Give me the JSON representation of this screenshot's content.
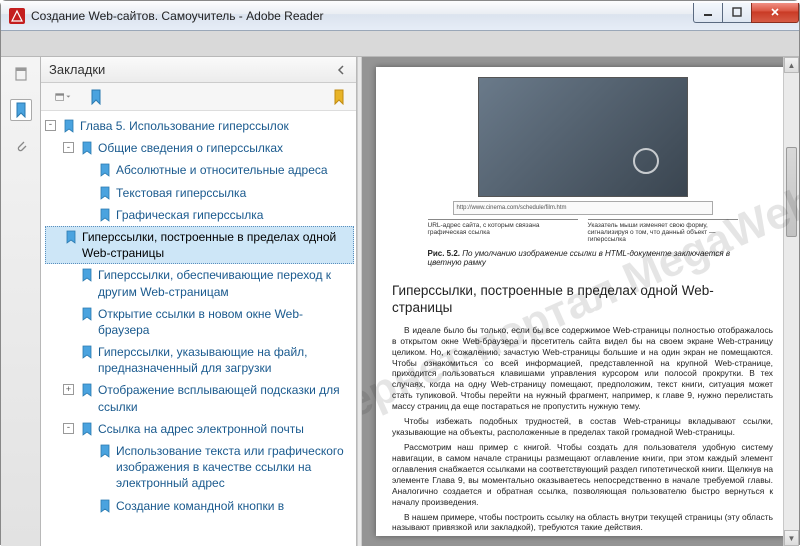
{
  "window": {
    "title": "Создание Web-сайтов. Самоучитель - Adobe Reader"
  },
  "bookmarks": {
    "panel_title": "Закладки",
    "items": [
      {
        "level": 1,
        "expander": "-",
        "label": "Глава 5. Использование гиперссылок",
        "selected": false
      },
      {
        "level": 2,
        "expander": "-",
        "label": "Общие сведения о гиперссылках",
        "selected": false
      },
      {
        "level": 3,
        "expander": "",
        "label": "Абсолютные и относительные адреса",
        "selected": false
      },
      {
        "level": 3,
        "expander": "",
        "label": "Текстовая гиперссылка",
        "selected": false
      },
      {
        "level": 3,
        "expander": "",
        "label": "Графическая гиперссылка",
        "selected": false
      },
      {
        "level": 2,
        "expander": "",
        "label": "Гиперссылки, построенные в пределах одной Web-страницы",
        "selected": true
      },
      {
        "level": 2,
        "expander": "",
        "label": "Гиперссылки, обеспечивающие переход к другим Web-страницам",
        "selected": false
      },
      {
        "level": 2,
        "expander": "",
        "label": "Открытие ссылки в новом окне Web-браузера",
        "selected": false
      },
      {
        "level": 2,
        "expander": "",
        "label": "Гиперссылки, указывающие на файл, предназначенный для загрузки",
        "selected": false
      },
      {
        "level": 2,
        "expander": "+",
        "label": "Отображение всплывающей подсказки для ссылки",
        "selected": false
      },
      {
        "level": 2,
        "expander": "-",
        "label": "Ссылка на адрес электронной почты",
        "selected": false
      },
      {
        "level": 3,
        "expander": "",
        "label": "Использование текста или графического изображения в качестве ссылки на электронный адрес",
        "selected": false
      },
      {
        "level": 3,
        "expander": "",
        "label": "Создание командной кнопки в",
        "selected": false
      }
    ]
  },
  "doc": {
    "url_bar": "http://www.cinema.com/schedule/film.htm",
    "annot_left": "URL-адрес сайта, с которым связана графическая ссылка",
    "annot_right": "Указатель мыши изменяет свою форму, сигнализируя о том, что данный объект — гиперссылка",
    "fig_num": "Рис. 5.2.",
    "fig_caption": " По умолчанию изображение ссылки в HTML-документе заключается в цветную рамку",
    "heading": "Гиперссылки, построенные в пределах одной Web-страницы",
    "p1": "В идеале было бы только, если бы все содержимое Web-страницы полностью отображалось в открытом окне Web-браузера и посетитель сайта видел бы на своем экране Web-страницу целиком. Но, к сожалению, зачастую Web-страницы большие и на один экран не помещаются. Чтобы ознакомиться со всей информацией, представленной на крупной Web-странице, приходится пользоваться клавишами управления курсором или полосой прокрутки. В тех случаях, когда на одну Web-страницу помещают, предположим, текст книги, ситуация может стать тупиковой. Чтобы перейти на нужный фрагмент, например, к главе 9, нужно перелистать массу страниц да еще постараться не пропустить нужную тему.",
    "p2": "Чтобы избежать подобных трудностей, в состав Web-страницы вкладывают ссылки, указывающие на объекты, расположенные в пределах такой громадной Web-страницы.",
    "p3": "Рассмотрим наш пример с книгой. Чтобы создать для пользователя удобную систему навигации, в самом начале страницы размещают оглавление книги, при этом каждый элемент оглавления снабжается ссылками на соответствующий раздел гипотетической книги. Щелкнув на элементе Глава 9, вы моментально оказываетесь непосредственно в начале требуемой главы. Аналогично создается и обратная ссылка, позволяющая пользователю быстро вернуться к началу произведения.",
    "p4": "В нашем примере, чтобы построить ссылку на область внутри текущей страницы (эту область называют привязкой или закладкой), требуются такие действия."
  },
  "watermark": "Интернет-портал MegaWebs.ru"
}
